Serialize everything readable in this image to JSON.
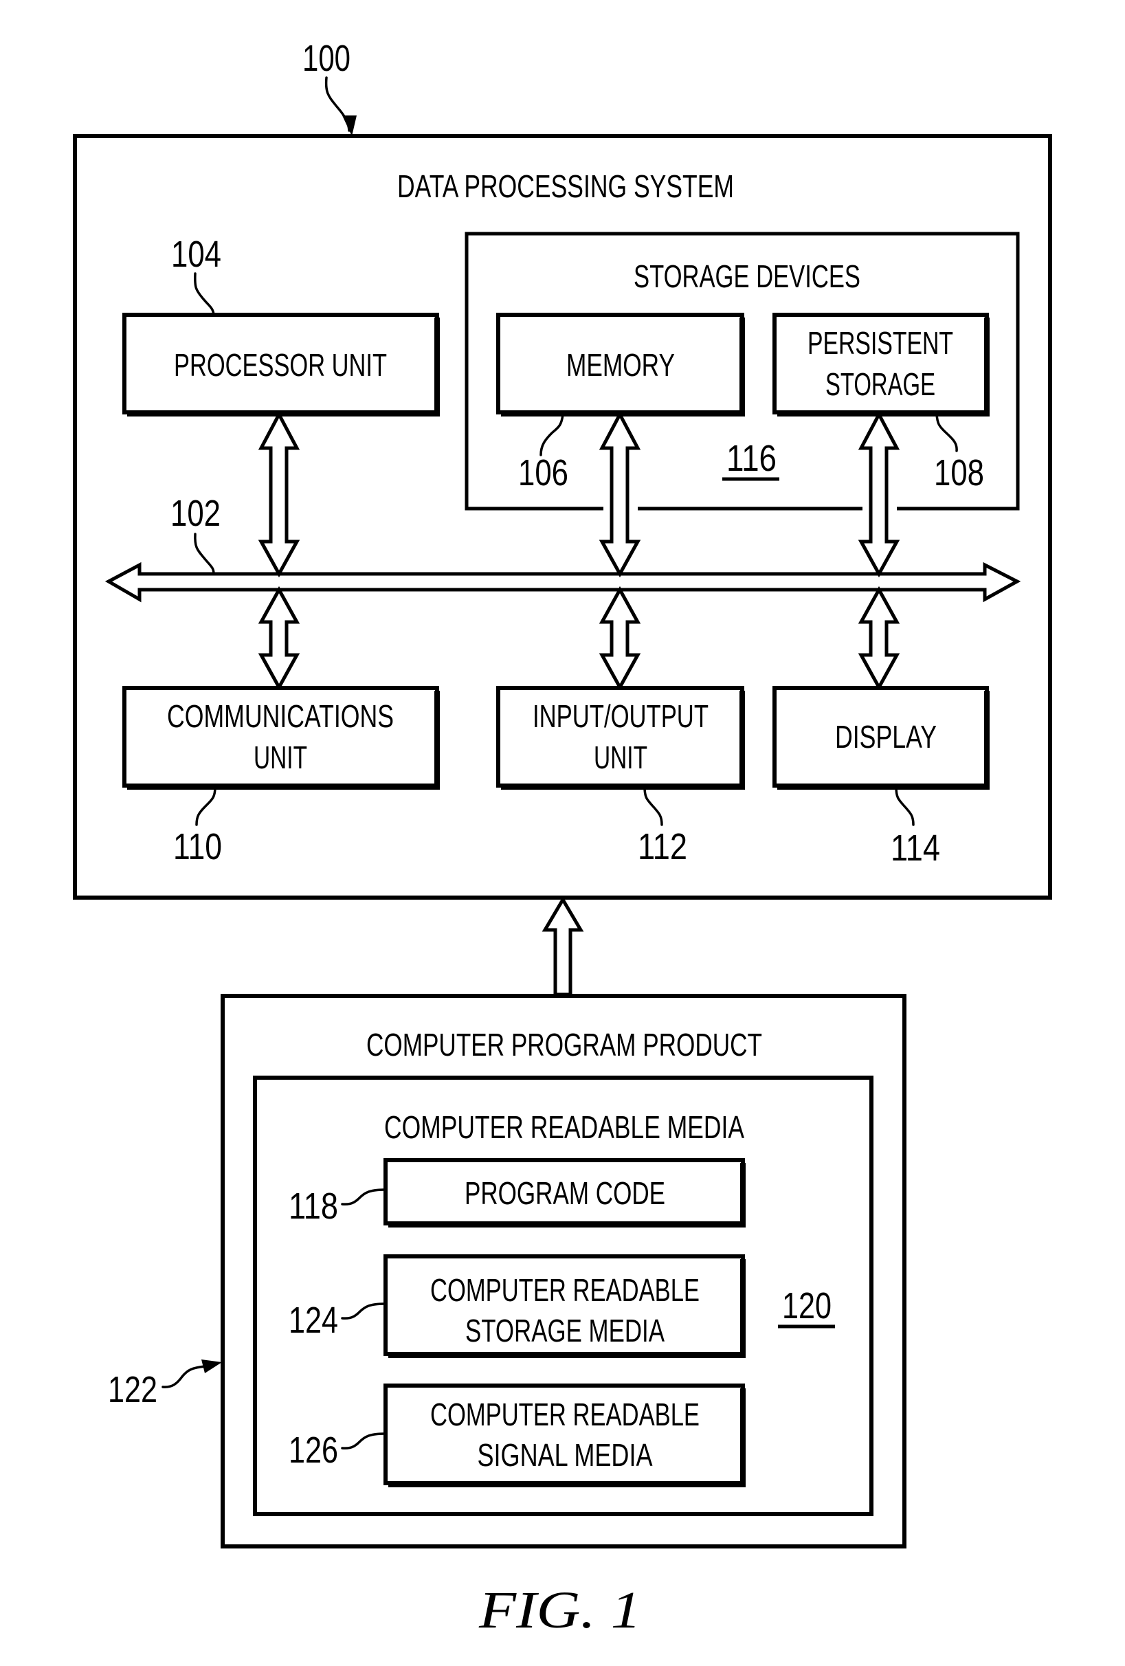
{
  "figure": {
    "caption": "FIG. 1",
    "ref": "100"
  },
  "data_processing_system": {
    "title": "DATA PROCESSING SYSTEM",
    "bus": {
      "ref": "102"
    },
    "processor_unit": {
      "label": "PROCESSOR UNIT",
      "ref": "104"
    },
    "storage_devices": {
      "title": "STORAGE DEVICES",
      "ref": "116",
      "memory": {
        "label": "MEMORY",
        "ref": "106"
      },
      "persistent_storage": {
        "label_lines": [
          "PERSISTENT",
          "STORAGE"
        ],
        "ref": "108"
      }
    },
    "communications_unit": {
      "label_lines": [
        "COMMUNICATIONS",
        "UNIT"
      ],
      "ref": "110"
    },
    "input_output_unit": {
      "label_lines": [
        "INPUT/OUTPUT",
        "UNIT"
      ],
      "ref": "112"
    },
    "display": {
      "label": "DISPLAY",
      "ref": "114"
    }
  },
  "computer_program_product": {
    "title": "COMPUTER PROGRAM PRODUCT",
    "ref": "122",
    "computer_readable_media": {
      "title": "COMPUTER READABLE MEDIA",
      "ref": "120",
      "program_code": {
        "label": "PROGRAM CODE",
        "ref": "118"
      },
      "storage_media": {
        "label_lines": [
          "COMPUTER READABLE",
          "STORAGE MEDIA"
        ],
        "ref": "124"
      },
      "signal_media": {
        "label_lines": [
          "COMPUTER READABLE",
          "SIGNAL MEDIA"
        ],
        "ref": "126"
      }
    }
  }
}
